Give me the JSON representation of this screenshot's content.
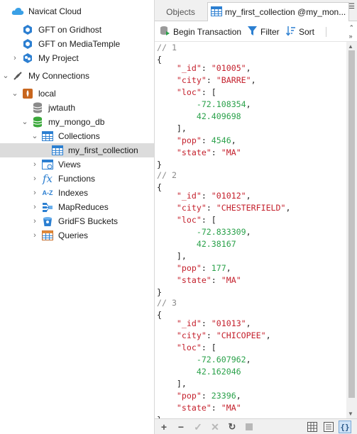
{
  "tree": {
    "navicat_cloud": "Navicat Cloud",
    "gft_gridhost": "GFT on Gridhost",
    "gft_mediatemple": "GFT on MediaTemple",
    "my_project": "My Project",
    "my_connections": "My Connections",
    "local": "local",
    "jwtauth": "jwtauth",
    "my_mongo_db": "my_mongo_db",
    "collections": "Collections",
    "my_first_collection": "my_first_collection",
    "views": "Views",
    "functions": "Functions",
    "indexes": "Indexes",
    "mapreduces": "MapReduces",
    "gridfs_buckets": "GridFS Buckets",
    "queries": "Queries"
  },
  "tabs": {
    "objects": "Objects",
    "collection": "my_first_collection @my_mon..."
  },
  "toolbar": {
    "begin_transaction": "Begin Transaction",
    "filter": "Filter",
    "sort": "Sort"
  },
  "documents": [
    {
      "comment": "// 1",
      "id": "\"01005\"",
      "city": "\"BARRE\"",
      "lng": "-72.108354",
      "lat": "42.409698",
      "pop": "4546",
      "state": "\"MA\""
    },
    {
      "comment": "// 2",
      "id": "\"01012\"",
      "city": "\"CHESTERFIELD\"",
      "lng": "-72.833309",
      "lat": "42.38167",
      "pop": "177",
      "state": "\"MA\""
    },
    {
      "comment": "// 3",
      "id": "\"01013\"",
      "city": "\"CHICOPEE\"",
      "lng": "-72.607962",
      "lat": "42.162046",
      "pop": "23396",
      "state": "\"MA\""
    }
  ],
  "syntax": {
    "open_brace": "{",
    "close_brace": "}",
    "key_id": "\"_id\"",
    "key_city": "\"city\"",
    "key_loc": "\"loc\"",
    "key_pop": "\"pop\"",
    "key_state": "\"state\"",
    "colon": ": ",
    "comma": ",",
    "open_bracket": "[",
    "close_bracket_comma": "],"
  },
  "colors": {
    "key": "#c4202c",
    "string": "#c4202c",
    "number": "#2aa14a",
    "comment": "#8a8a8a",
    "selection": "#dcdcdc",
    "accent": "#1e88e5"
  }
}
